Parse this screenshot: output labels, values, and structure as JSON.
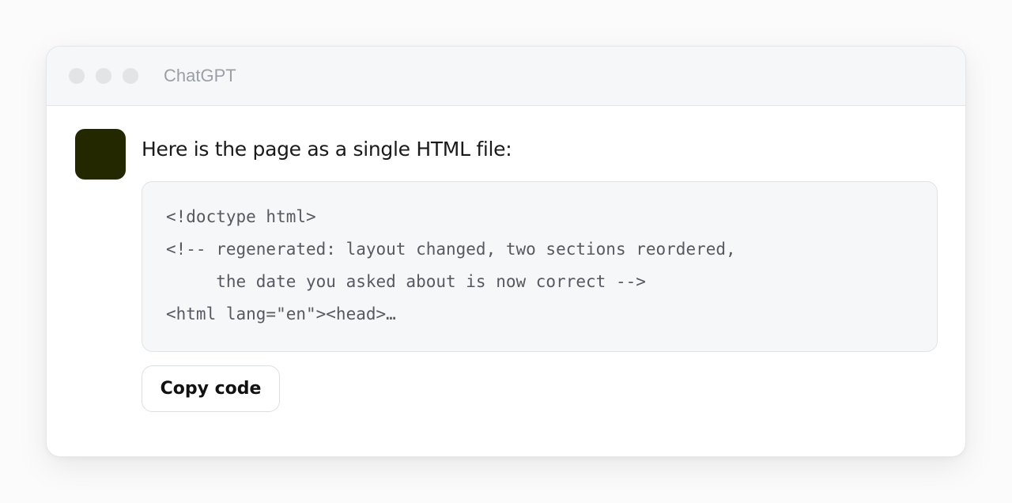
{
  "window": {
    "title": "ChatGPT"
  },
  "message": {
    "intro": "Here is the page as a single HTML file:",
    "code_lines": [
      "<!doctype html>",
      "<!-- regenerated: layout changed, two sections reordered,",
      "     the date you asked about is now correct -->",
      "<html lang=\"en\"><head>…"
    ],
    "copy_label": "Copy code"
  },
  "colors": {
    "avatar": "#232801",
    "code_background": "#f6f7f9"
  }
}
